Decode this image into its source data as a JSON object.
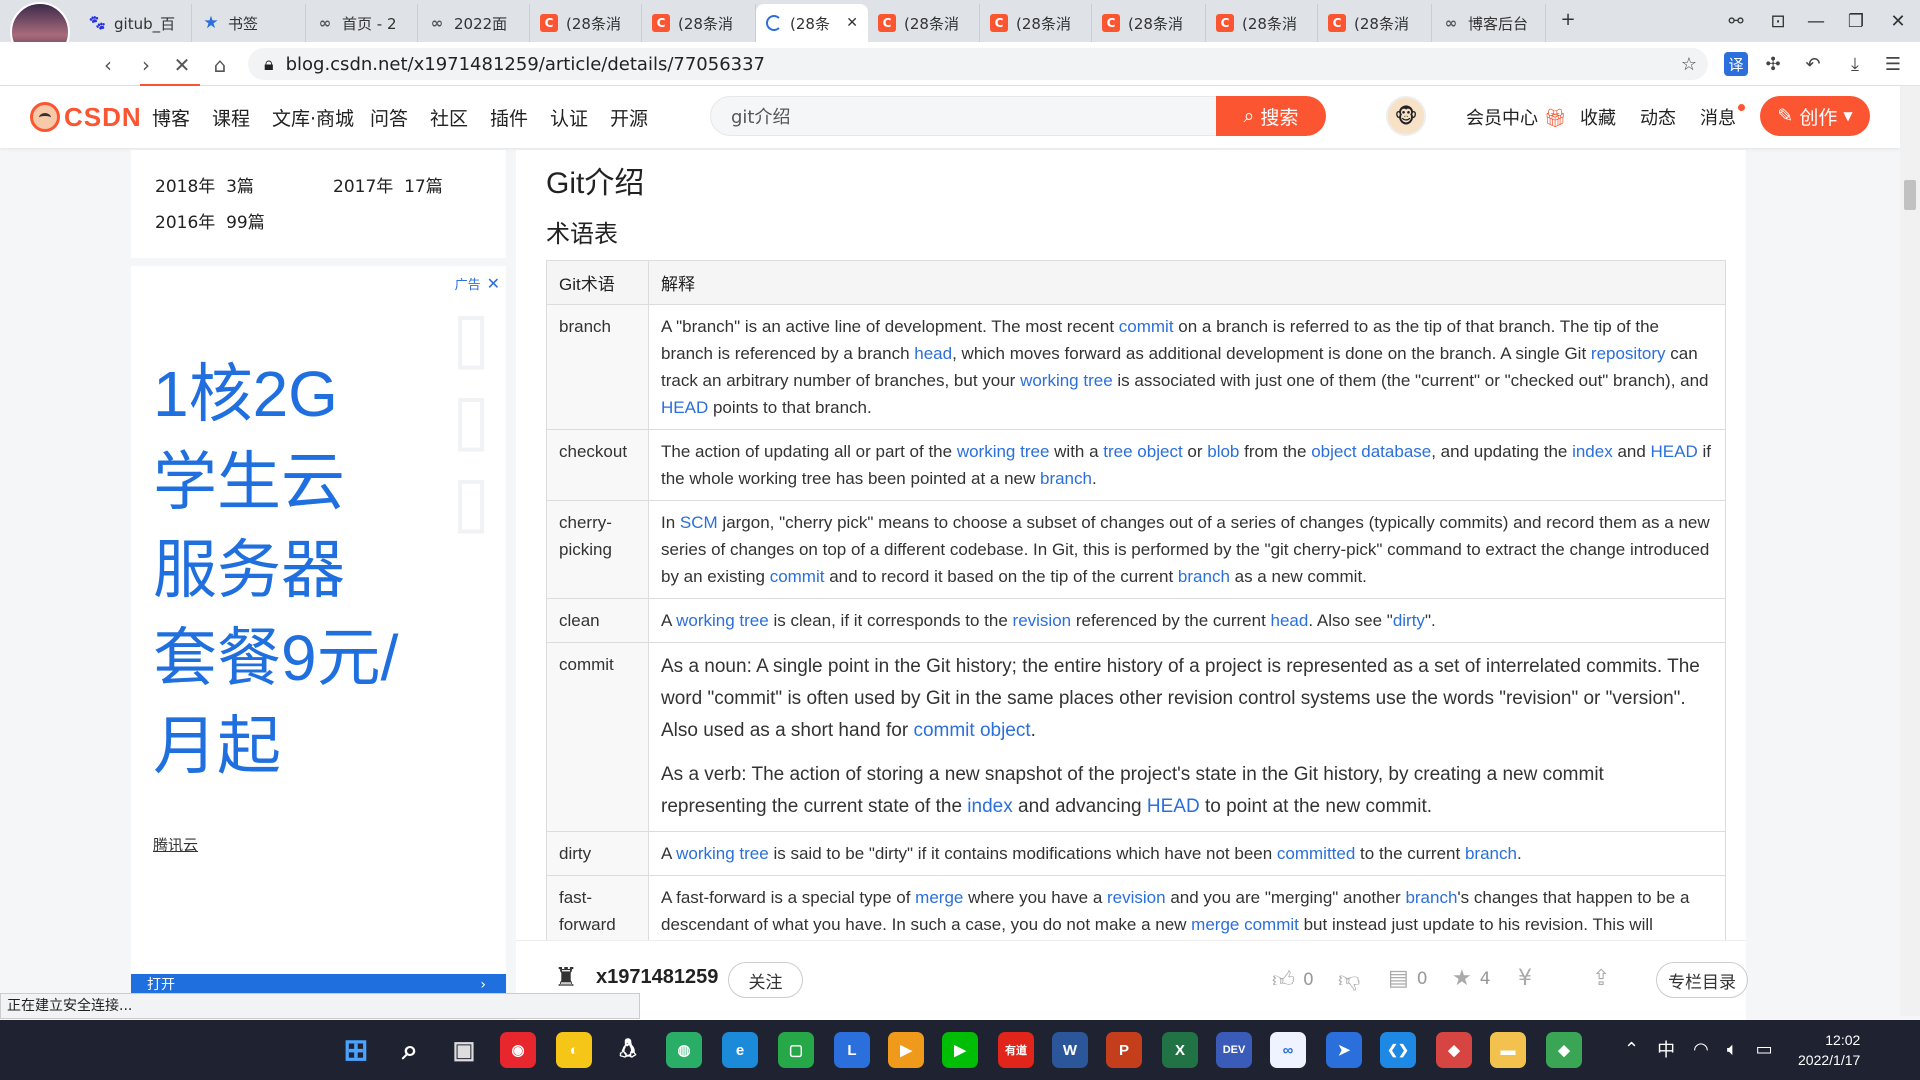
{
  "browser": {
    "tabs": [
      {
        "title": "gitub_百",
        "icon": "baidu-paw"
      },
      {
        "title": "书签",
        "icon": "star"
      },
      {
        "title": "首页 - 2",
        "icon": "loop"
      },
      {
        "title": "2022面",
        "icon": "loop"
      },
      {
        "title": "(28条消",
        "icon": "csdn"
      },
      {
        "title": "(28条消",
        "icon": "csdn"
      },
      {
        "title": "(28条",
        "icon": "loading",
        "active": true
      },
      {
        "title": "(28条消",
        "icon": "csdn"
      },
      {
        "title": "(28条消",
        "icon": "csdn"
      },
      {
        "title": "(28条消",
        "icon": "csdn"
      },
      {
        "title": "(28条消",
        "icon": "csdn"
      },
      {
        "title": "(28条消",
        "icon": "csdn"
      },
      {
        "title": "博客后台",
        "icon": "loop"
      }
    ],
    "new_tab": "+",
    "url": "blog.csdn.net/x1971481259/article/details/77056337",
    "translate_label": "译",
    "status_text": "正在建立安全连接..."
  },
  "csdn": {
    "logo_text": "CSDN",
    "nav": [
      "博客",
      "课程",
      "文库·商城",
      "问答",
      "社区",
      "插件",
      "认证",
      "开源"
    ],
    "search_value": "git介绍",
    "search_button": "搜索",
    "member_center": "会员中心",
    "favorites": "收藏",
    "activity": "动态",
    "messages": "消息",
    "create_button": "创作"
  },
  "sidebar": {
    "archive": [
      {
        "year": "2018年",
        "count": "3篇"
      },
      {
        "year": "2017年",
        "count": "17篇"
      },
      {
        "year": "2016年",
        "count": "99篇"
      }
    ],
    "ad": {
      "tag": "广告",
      "headline": [
        "1核2G",
        "学生云",
        "服务器",
        "套餐9元/",
        "月起"
      ],
      "brand": "腾讯云",
      "bottom_label": "打开"
    }
  },
  "article": {
    "title": "Git介绍",
    "subtitle": "术语表",
    "table_headers": [
      "Git术语",
      "解释"
    ],
    "rows": [
      {
        "term": "branch",
        "paras": [
          [
            {
              "t": "A \"branch\" is an active line of development. The most recent "
            },
            {
              "t": "commit",
              "link": true
            },
            {
              "t": " on a branch is referred to as the tip of that branch. The tip of the branch is referenced by a branch "
            },
            {
              "t": "head",
              "link": true
            },
            {
              "t": ", which moves forward as additional development is done on the branch. A single Git "
            },
            {
              "t": "repository",
              "link": true
            },
            {
              "t": " can track an arbitrary number of branches, but your "
            },
            {
              "t": "working tree",
              "link": true
            },
            {
              "t": " is associated with just one of them (the \"current\" or \"checked out\" branch), and "
            },
            {
              "t": "HEAD",
              "link": true
            },
            {
              "t": " points to that branch."
            }
          ]
        ]
      },
      {
        "term": "checkout",
        "paras": [
          [
            {
              "t": "The action of updating all or part of the "
            },
            {
              "t": "working tree",
              "link": true
            },
            {
              "t": " with a "
            },
            {
              "t": "tree object",
              "link": true
            },
            {
              "t": " or "
            },
            {
              "t": "blob",
              "link": true
            },
            {
              "t": " from the "
            },
            {
              "t": "object database",
              "link": true
            },
            {
              "t": ", and updating the "
            },
            {
              "t": "index",
              "link": true
            },
            {
              "t": " and "
            },
            {
              "t": "HEAD",
              "link": true
            },
            {
              "t": " if the whole working tree has been pointed at a new "
            },
            {
              "t": "branch",
              "link": true
            },
            {
              "t": "."
            }
          ]
        ]
      },
      {
        "term": "cherry-picking",
        "paras": [
          [
            {
              "t": "In "
            },
            {
              "t": "SCM",
              "link": true
            },
            {
              "t": " jargon, \"cherry pick\" means to choose a subset of changes out of a series of changes (typically commits) and record them as a new series of changes on top of a different codebase. In Git, this is performed by the \"git cherry-pick\" command to extract the change introduced by an existing "
            },
            {
              "t": "commit",
              "link": true
            },
            {
              "t": " and to record it based on the tip of the current "
            },
            {
              "t": "branch",
              "link": true
            },
            {
              "t": " as a new commit."
            }
          ]
        ]
      },
      {
        "term": "clean",
        "paras": [
          [
            {
              "t": "A "
            },
            {
              "t": "working tree",
              "link": true
            },
            {
              "t": " is clean, if it corresponds to the "
            },
            {
              "t": "revision",
              "link": true
            },
            {
              "t": " referenced by the current "
            },
            {
              "t": "head",
              "link": true
            },
            {
              "t": ". Also see \""
            },
            {
              "t": "dirty",
              "link": true
            },
            {
              "t": "\"."
            }
          ]
        ]
      },
      {
        "term": "commit",
        "big": true,
        "paras": [
          [
            {
              "t": "As a noun: A single point in the Git history; the entire history of a project is represented as a set of interrelated commits. The word \"commit\" is often used by Git in the same places other revision control systems use the words \"revision\" or \"version\". Also used as a short hand for "
            },
            {
              "t": "commit object",
              "link": true
            },
            {
              "t": "."
            }
          ],
          [
            {
              "t": "As a verb: The action of storing a new snapshot of the project's state in the Git history, by creating a new commit representing the current state of the "
            },
            {
              "t": "index",
              "link": true
            },
            {
              "t": " and advancing "
            },
            {
              "t": "HEAD",
              "link": true
            },
            {
              "t": " to point at the new commit."
            }
          ]
        ]
      },
      {
        "term": "dirty",
        "paras": [
          [
            {
              "t": "A "
            },
            {
              "t": "working tree",
              "link": true
            },
            {
              "t": " is said to be \"dirty\" if it contains modifications which have not been "
            },
            {
              "t": "committed",
              "link": true
            },
            {
              "t": " to the current "
            },
            {
              "t": "branch",
              "link": true
            },
            {
              "t": "."
            }
          ]
        ]
      },
      {
        "term": "fast-forward",
        "paras": [
          [
            {
              "t": "A fast-forward is a special type of "
            },
            {
              "t": "merge",
              "link": true
            },
            {
              "t": " where you have a "
            },
            {
              "t": "revision",
              "link": true
            },
            {
              "t": " and you are \"merging\" another "
            },
            {
              "t": "branch",
              "link": true
            },
            {
              "t": "'s changes that happen to be a descendant of what you have. In such a case, you do not make a new "
            },
            {
              "t": "merge commit",
              "link": true
            },
            {
              "t": " but instead just update to his revision. This will"
            }
          ]
        ]
      }
    ]
  },
  "bottom": {
    "author": "x1971481259",
    "follow": "关注",
    "likes": "0",
    "comments": "0",
    "stars": "4",
    "column_dir": "专栏目录"
  },
  "taskbar": {
    "apps": [
      "windows-start",
      "search",
      "task-view",
      "netease-music",
      "browser-yellow",
      "qq",
      "wechat",
      "edge",
      "wechat-work",
      "l-app",
      "tencent-video",
      "iqiyi",
      "youdao",
      "word",
      "powerpoint",
      "excel",
      "dev-cpp",
      "baidu-netdisk",
      "feishu",
      "vscode",
      "git-extensions",
      "file-explorer",
      "sourcetree"
    ],
    "youdao_label": "有道",
    "word_label": "W",
    "ppt_label": "P",
    "excel_label": "X",
    "dev_label": "DEV",
    "ime": "中",
    "time": "12:02",
    "date": "2022/1/17"
  }
}
